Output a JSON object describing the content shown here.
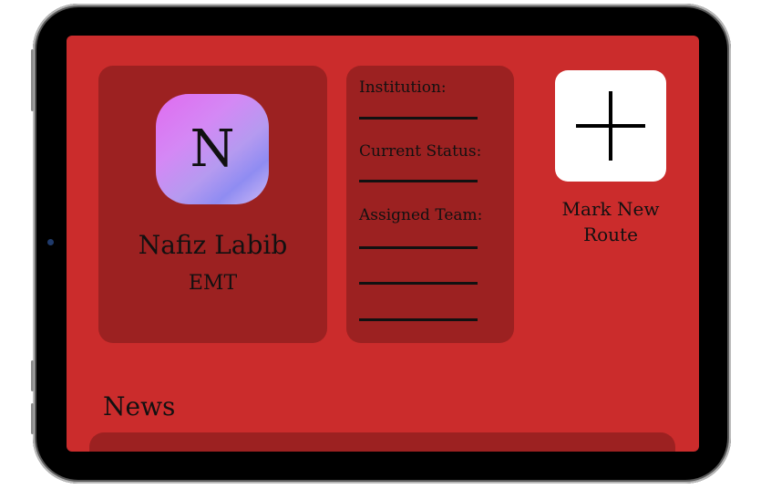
{
  "profile": {
    "avatar_letter": "N",
    "name": "Nafiz Labib",
    "role": "EMT"
  },
  "info": {
    "institution_label": "Institution:",
    "status_label": "Current Status:",
    "team_label": "Assigned Team:"
  },
  "actions": {
    "add_icon": "plus-icon",
    "mark_route_line1": "Mark New",
    "mark_route_line2": "Route"
  },
  "news": {
    "title": "News"
  },
  "colors": {
    "screen_bg": "#cb2c2c",
    "card_bg": "#9c2121"
  }
}
